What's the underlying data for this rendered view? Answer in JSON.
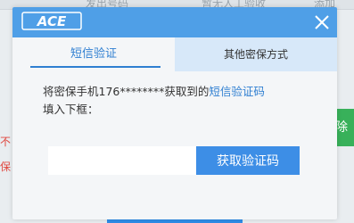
{
  "background": {
    "topbar_items": [
      "发出号码",
      "暂无人工验收",
      "添加"
    ],
    "red_text_1": "不",
    "red_text_2": "保",
    "green_button_label": "除"
  },
  "modal": {
    "logo_text": "ACE",
    "close_icon": "close-icon",
    "tabs": [
      {
        "label": "短信验证",
        "active": true
      },
      {
        "label": "其他密保方式",
        "active": false
      }
    ],
    "desc_prefix": "将密保手机176********获取到的",
    "desc_link": "短信验证码",
    "desc_suffix": "填入下框：",
    "code_input_value": "",
    "code_input_placeholder": "",
    "get_code_label": "获取验证码"
  },
  "colors": {
    "header": "#4f9fe7",
    "accent": "#2f7fd1",
    "button": "#3d8ee6",
    "inactive_tab": "#d7e8f9"
  }
}
